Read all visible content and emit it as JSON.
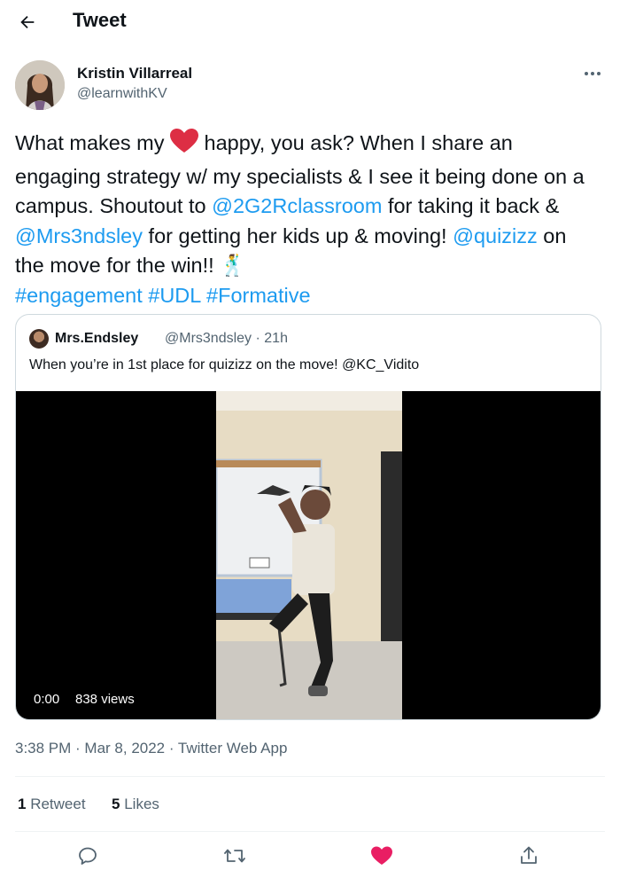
{
  "header": {
    "title": "Tweet"
  },
  "author": {
    "name": "Kristin Villarreal",
    "handle": "@learnwithKV"
  },
  "tweet": {
    "t1": "What makes my ",
    "t2": " happy, you ask? When I share an engaging strategy w/ my specialists & I see it being done on a campus. Shoutout to ",
    "m1": "@2G2Rclassroom",
    "t3": " for taking it back & ",
    "m2": "@Mrs3ndsley",
    "t4": " for getting her kids up & moving! ",
    "m3": "@quizizz",
    "t5": " on the move for the win!! ",
    "emoji_dancer": "🕺",
    "hashtags": [
      "#engagement",
      "#UDL",
      "#Formative"
    ]
  },
  "quote": {
    "name": "Mrs.Endsley",
    "handle_time": "@Mrs3ndsley · 21h",
    "text": "When you’re in 1st place for quizizz on the move! @KC_Vidito",
    "video": {
      "time": "0:00",
      "views": "838 views"
    }
  },
  "meta": {
    "timestamp": "3:38 PM · Mar 8, 2022 · Twitter Web App"
  },
  "stats": {
    "retweets_count": "1",
    "retweets_label": " Retweet",
    "likes_count": "5",
    "likes_label": " Likes"
  },
  "icons": {
    "back": "back-arrow-icon",
    "more": "more-icon",
    "reply": "reply-icon",
    "retweet": "retweet-icon",
    "like": "heart-icon",
    "share": "share-icon"
  },
  "colors": {
    "link": "#1d9bf0",
    "heart": "#e91e63",
    "secondary_text": "#536471",
    "border": "#cfd9de"
  }
}
